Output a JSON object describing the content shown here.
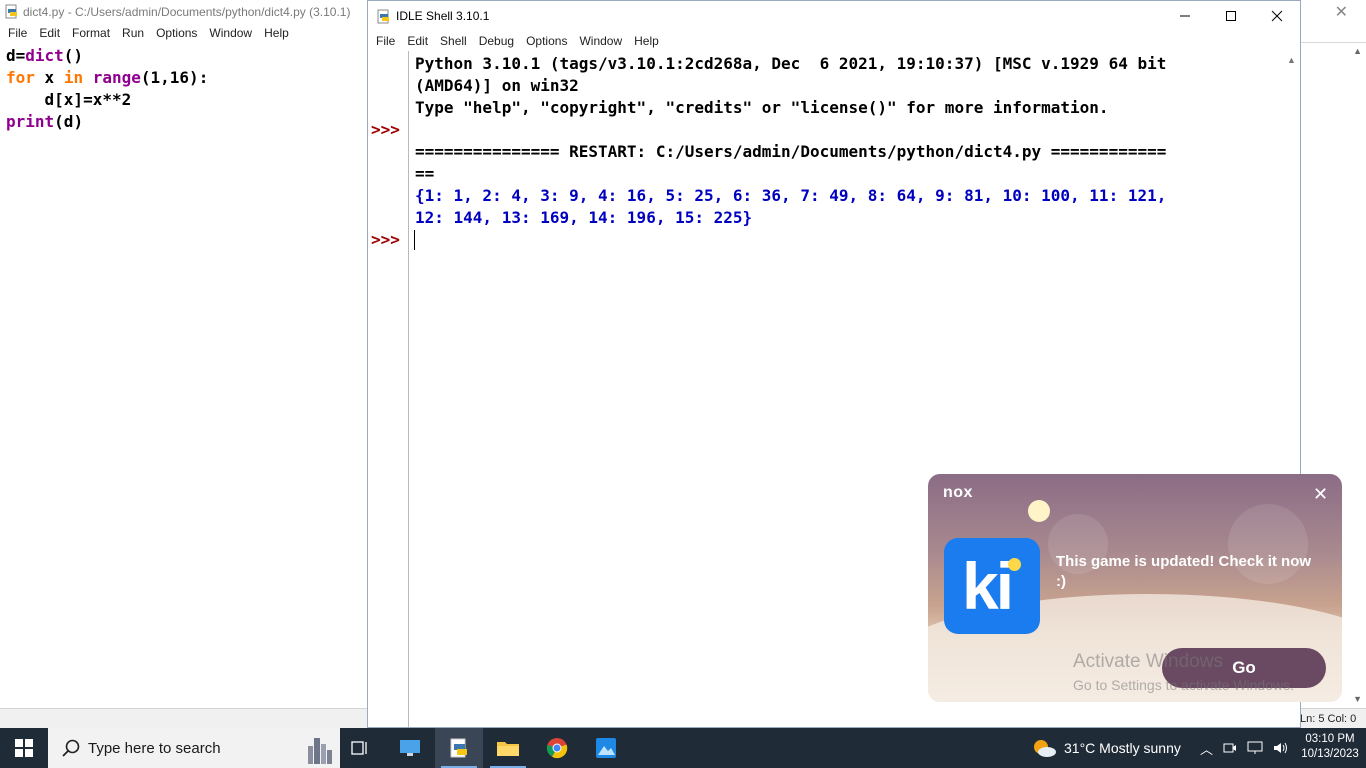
{
  "editor": {
    "title": "dict4.py - C:/Users/admin/Documents/python/dict4.py (3.10.1)",
    "menu": [
      "File",
      "Edit",
      "Format",
      "Run",
      "Options",
      "Window",
      "Help"
    ],
    "code": {
      "line1_a": "d=",
      "line1_b": "dict",
      "line1_c": "()",
      "line2_a": "for",
      "line2_b": " x ",
      "line2_c": "in",
      "line2_d": " ",
      "line2_e": "range",
      "line2_f": "(1,16):",
      "line3": "    d[x]=x**2",
      "line4_a": "print",
      "line4_b": "(d)"
    }
  },
  "background_app": {
    "status": "Ln: 5   Col: 0"
  },
  "shell": {
    "title": "IDLE Shell 3.10.1",
    "menu": [
      "File",
      "Edit",
      "Shell",
      "Debug",
      "Options",
      "Window",
      "Help"
    ],
    "prompt": ">>>",
    "lines": [
      "Python 3.10.1 (tags/v3.10.1:2cd268a, Dec  6 2021, 19:10:37) [MSC v.1929 64 bit",
      "(AMD64)] on win32",
      "Type \"help\", \"copyright\", \"credits\" or \"license()\" for more information.",
      "",
      "=============== RESTART: C:/Users/admin/Documents/python/dict4.py ============",
      "==",
      "{1: 1, 2: 4, 3: 9, 4: 16, 5: 25, 6: 36, 7: 49, 8: 64, 9: 81, 10: 100, 11: 121,",
      "12: 144, 13: 169, 14: 196, 15: 225}"
    ]
  },
  "notification": {
    "brand": "nox",
    "app_icon_text": "ki",
    "message": "This game is updated! Check it now :)",
    "button": "Go",
    "close": "✕"
  },
  "watermark": {
    "line1": "Activate Windows",
    "line2": "Go to Settings to activate Windows."
  },
  "taskbar": {
    "search_placeholder": "Type here to search",
    "weather": "31°C  Mostly sunny",
    "time": "03:10 PM",
    "date": "10/13/2023"
  },
  "colors": {
    "keyword": "#ff7700",
    "builtin": "#900090",
    "output": "#0000c0",
    "prompt": "#a00000",
    "taskbar": "#202b38"
  }
}
